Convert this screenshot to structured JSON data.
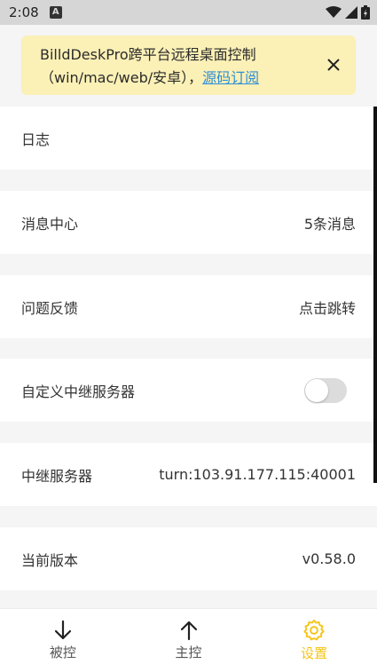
{
  "statusbar": {
    "time": "2:08",
    "badge": "A"
  },
  "banner": {
    "text": "BilldDeskPro跨平台远程桌面控制（win/mac/web/安卓），",
    "link": "源码订阅"
  },
  "settings": {
    "log": {
      "label": "日志"
    },
    "messages": {
      "label": "消息中心",
      "value": "5条消息"
    },
    "feedback": {
      "label": "问题反馈",
      "value": "点击跳转"
    },
    "custom_relay": {
      "label": "自定义中继服务器",
      "enabled": false
    },
    "relay_server": {
      "label": "中继服务器",
      "value": "turn:103.91.177.115:40001"
    },
    "version": {
      "label": "当前版本",
      "value": "v0.58.0"
    }
  },
  "nav": {
    "items": [
      {
        "label": "被控",
        "icon": "arrow-down-icon"
      },
      {
        "label": "主控",
        "icon": "arrow-up-icon"
      },
      {
        "label": "设置",
        "icon": "gear-icon",
        "active": true
      }
    ],
    "active_color": "#f5c518"
  }
}
